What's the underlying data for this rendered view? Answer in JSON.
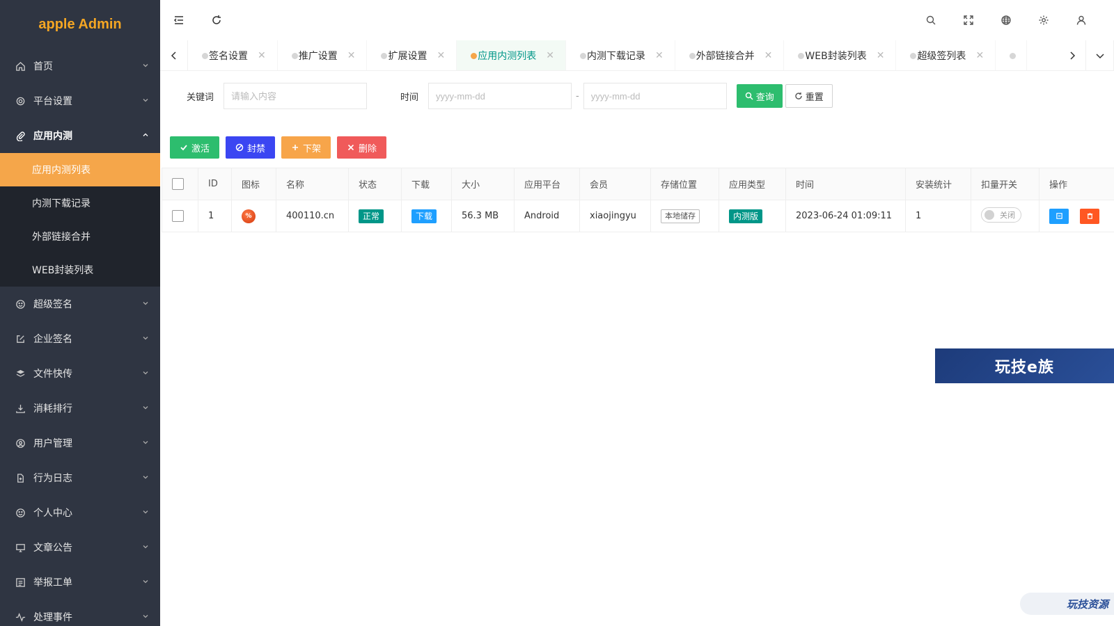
{
  "app": {
    "logo": "apple Admin"
  },
  "sidebar": {
    "menu": [
      {
        "label": "首页",
        "icon": "home-icon"
      },
      {
        "label": "平台设置",
        "icon": "gear-icon"
      },
      {
        "label": "应用内测",
        "icon": "paperclip-icon",
        "open": true,
        "children": [
          {
            "label": "应用内测列表",
            "active": true
          },
          {
            "label": "内测下载记录"
          },
          {
            "label": "外部链接合并"
          },
          {
            "label": "WEB封装列表"
          }
        ]
      },
      {
        "label": "超级签名",
        "icon": "smile-icon"
      },
      {
        "label": "企业签名",
        "icon": "edit-icon"
      },
      {
        "label": "文件快传",
        "icon": "layers-icon"
      },
      {
        "label": "消耗排行",
        "icon": "download-icon"
      },
      {
        "label": "用户管理",
        "icon": "user-circle-icon"
      },
      {
        "label": "行为日志",
        "icon": "file-icon"
      },
      {
        "label": "个人中心",
        "icon": "smile-icon"
      },
      {
        "label": "文章公告",
        "icon": "monitor-icon"
      },
      {
        "label": "举报工单",
        "icon": "list-icon"
      },
      {
        "label": "处理事件",
        "icon": "activity-icon"
      }
    ]
  },
  "tabs": [
    {
      "label": "签名设置"
    },
    {
      "label": "推广设置"
    },
    {
      "label": "扩展设置"
    },
    {
      "label": "应用内测列表",
      "active": true
    },
    {
      "label": "内测下载记录"
    },
    {
      "label": "外部链接合并"
    },
    {
      "label": "WEB封装列表"
    },
    {
      "label": "超级签列表"
    }
  ],
  "search": {
    "keyword_label": "关键词",
    "keyword_placeholder": "请输入内容",
    "time_label": "时间",
    "date_placeholder": "yyyy-mm-dd",
    "separator": "-",
    "query_label": "查询",
    "reset_label": "重置"
  },
  "toolbar": {
    "activate": "激活",
    "ban": "封禁",
    "offline": "下架",
    "delete": "删除"
  },
  "table": {
    "headers": [
      "ID",
      "图标",
      "名称",
      "状态",
      "下载",
      "大小",
      "应用平台",
      "会员",
      "存储位置",
      "应用类型",
      "时间",
      "安装统计",
      "扣量开关",
      "操作"
    ],
    "rows": [
      {
        "id": "1",
        "icon_text": "%",
        "name": "400110.cn",
        "status": "正常",
        "download": "下载",
        "size": "56.3 MB",
        "platform": "Android",
        "member": "xiaojingyu",
        "storage": "本地储存",
        "type": "内测版",
        "time": "2023-06-24 01:09:11",
        "installs": "1",
        "switch": "关闭"
      }
    ]
  },
  "watermarks": {
    "banner": "玩技e族",
    "badge": "玩技资源"
  },
  "colors": {
    "sidebar_bg": "#2f3542",
    "active_orange": "#f5a64a",
    "green": "#2dbd6e",
    "teal": "#009688",
    "blue_ban": "#3b46f2",
    "orange_offline": "#f7a54a",
    "red_delete": "#f05a5a",
    "download_blue": "#1e9fff"
  }
}
